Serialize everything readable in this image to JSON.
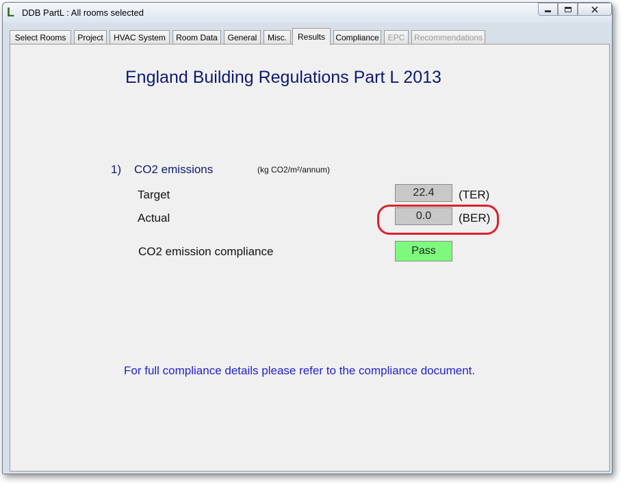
{
  "window": {
    "icon_letter": "L",
    "title": "DDB PartL : All rooms selected"
  },
  "tabs": [
    {
      "label": "Select Rooms",
      "state": "normal"
    },
    {
      "label": "Project",
      "state": "normal"
    },
    {
      "label": "HVAC System",
      "state": "normal"
    },
    {
      "label": "Room Data",
      "state": "normal"
    },
    {
      "label": "General",
      "state": "normal"
    },
    {
      "label": "Misc.",
      "state": "normal"
    },
    {
      "label": "Results",
      "state": "active"
    },
    {
      "label": "Compliance",
      "state": "normal"
    },
    {
      "label": "EPC",
      "state": "disabled"
    },
    {
      "label": "Recommendations",
      "state": "disabled"
    }
  ],
  "results": {
    "heading": "England Building Regulations Part L 2013",
    "section": {
      "number": "1)",
      "title": "CO2 emissions",
      "units": "(kg CO2/m²/annum)"
    },
    "rows": {
      "target": {
        "label": "Target",
        "value": "22.4",
        "suffix": "(TER)"
      },
      "actual": {
        "label": "Actual",
        "value": "0.0",
        "suffix": "(BER)"
      },
      "compliance": {
        "label": "CO2 emission compliance",
        "value": "Pass"
      }
    },
    "footnote": "For full compliance details please refer to the compliance document."
  },
  "colors": {
    "heading": "#0c1a6e",
    "footnote": "#2222cc",
    "pass": "#7dfa7d",
    "value_box": "#c8c8c8",
    "highlight_annotation": "#d9202a"
  }
}
